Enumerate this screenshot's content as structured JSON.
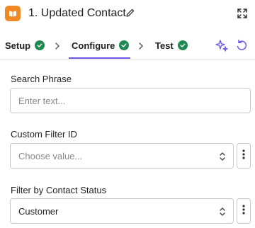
{
  "header": {
    "step_title": "1. Updated Contact"
  },
  "tabs": [
    {
      "label": "Setup",
      "status": "complete"
    },
    {
      "label": "Configure",
      "status": "complete",
      "active": true
    },
    {
      "label": "Test",
      "status": "complete"
    }
  ],
  "form": {
    "search_phrase": {
      "label": "Search Phrase",
      "placeholder": "Enter text...",
      "value": ""
    },
    "custom_filter_id": {
      "label": "Custom Filter ID",
      "placeholder": "Choose value...",
      "value": ""
    },
    "contact_status": {
      "label": "Filter by Contact Status",
      "value": "Customer"
    }
  },
  "colors": {
    "accent": "#695be8",
    "success": "#1e8a52",
    "app_icon": "#f08a24"
  },
  "icons": [
    "app-book-icon",
    "pencil-icon",
    "expand-icon",
    "check-circle-icon",
    "chevron-right-icon",
    "sparkle-icon",
    "undo-icon",
    "sort-icon",
    "more-vertical-icon"
  ]
}
